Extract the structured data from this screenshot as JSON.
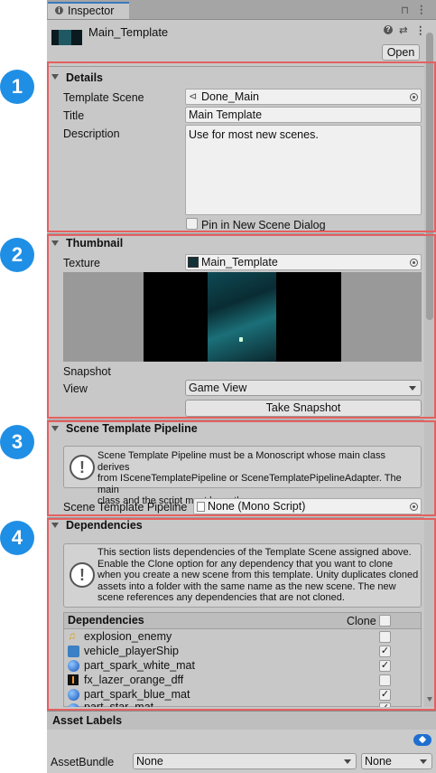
{
  "tab": {
    "label": "Inspector"
  },
  "header": {
    "asset_name": "Main_Template",
    "open_label": "Open",
    "help_glyph": "?",
    "settings_glyph": "⇄",
    "menu_glyph": "⋮",
    "lock_glyph": "🔒"
  },
  "badges": [
    "1",
    "2",
    "3",
    "4"
  ],
  "details": {
    "title": "Details",
    "template_scene_label": "Template Scene",
    "template_scene_value": "Done_Main",
    "title_label": "Title",
    "title_value": "Main Template",
    "description_label": "Description",
    "description_value": "Use for most new scenes.",
    "pin_label": "Pin in New Scene Dialog"
  },
  "thumbnail": {
    "title": "Thumbnail",
    "texture_label": "Texture",
    "texture_value": "Main_Template",
    "snapshot_label": "Snapshot",
    "view_label": "View",
    "view_value": "Game View",
    "take_snapshot_label": "Take Snapshot"
  },
  "pipeline": {
    "title": "Scene Template Pipeline",
    "help_line1": "Scene Template Pipeline must be a Monoscript whose main class derives",
    "help_line2": "from ISceneTemplatePipeline or SceneTemplatePipelineAdapter. The main",
    "help_line3": "class and the script must have the same name.",
    "field_label": "Scene Template Pipeline",
    "field_value": "None (Mono Script)"
  },
  "dependencies": {
    "title": "Dependencies",
    "help_line1": "This section lists dependencies of the Template Scene assigned above.",
    "help_line2": "Enable the Clone option for any dependency that you want to clone",
    "help_line3": "when you create a new scene from this template. Unity duplicates cloned",
    "help_line4": "assets into a folder with the same name as the new scene. The new",
    "help_line5": "scene references any dependencies that are not cloned.",
    "header_label": "Dependencies",
    "clone_label": "Clone",
    "items": [
      {
        "name": "explosion_enemy",
        "checked": false,
        "icon": "audio-icon"
      },
      {
        "name": "vehicle_playerShip",
        "checked": true,
        "icon": "prefab-icon"
      },
      {
        "name": "part_spark_white_mat",
        "checked": true,
        "icon": "material-icon"
      },
      {
        "name": "fx_lazer_orange_dff",
        "checked": false,
        "icon": "texture-icon"
      },
      {
        "name": "part_spark_blue_mat",
        "checked": true,
        "icon": "material-icon"
      },
      {
        "name": "part_star_mat",
        "checked": true,
        "icon": "material-icon"
      }
    ]
  },
  "footer": {
    "asset_labels": "Asset Labels",
    "assetbundle_label": "AssetBundle",
    "bundle_value": "None",
    "variant_value": "None"
  }
}
